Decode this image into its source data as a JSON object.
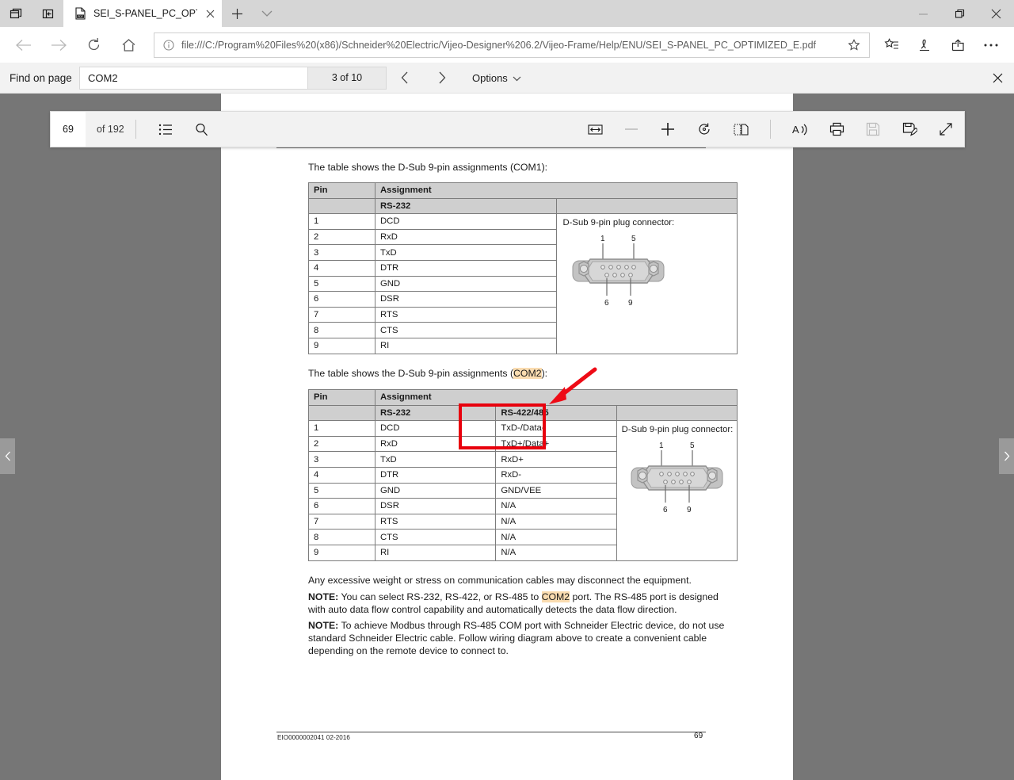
{
  "window": {
    "system_buttons": [
      "tab-preview-icon",
      "set-aside-tabs-icon"
    ],
    "controls": {
      "minimize": "minimize-icon",
      "restore": "restore-icon",
      "close": "close-icon"
    }
  },
  "tabstrip": {
    "tab_title": "SEI_S-PANEL_PC_OPTIM",
    "tab_icon": "pdf-file-icon",
    "close_icon": "close-icon",
    "new_tab_icon": "plus-icon",
    "tab_menu_icon": "chevron-down-icon"
  },
  "navbar": {
    "back_icon": "back-arrow-icon",
    "forward_icon": "forward-arrow-icon",
    "refresh_icon": "refresh-icon",
    "home_icon": "home-icon",
    "info_icon": "info-circle-icon",
    "url": "file:///C:/Program%20Files%20(x86)/Schneider%20Electric/Vijeo-Designer%206.2/Vijeo-Frame/Help/ENU/SEI_S-PANEL_PC_OPTIMIZED_E.pdf",
    "star_icon": "favorite-star-icon",
    "actions": [
      {
        "name": "hub-favorites-icon",
        "label": "Hub"
      },
      {
        "name": "web-notes-icon",
        "label": "Make a Web Note"
      },
      {
        "name": "share-icon",
        "label": "Share"
      },
      {
        "name": "more-icon",
        "label": "More"
      }
    ]
  },
  "findbar": {
    "label": "Find on page",
    "query": "COM2",
    "placeholder": "Find on page",
    "match_count": "3 of 10",
    "prev_icon": "chevron-left-icon",
    "next_icon": "chevron-right-icon",
    "options_label": "Options",
    "options_caret": "chevron-down-icon",
    "close_icon": "close-icon"
  },
  "pdf_toolbar": {
    "current_page": "69",
    "total_pages": "of 192",
    "toc_icon": "table-of-contents-icon",
    "search_icon": "search-icon",
    "tools": [
      {
        "name": "fit-to-width-icon",
        "disabled": false
      },
      {
        "name": "zoom-out-icon",
        "disabled": true
      },
      {
        "name": "zoom-in-icon",
        "disabled": false
      },
      {
        "name": "rotate-icon",
        "disabled": false
      },
      {
        "name": "page-layout-icon",
        "disabled": false
      },
      {
        "name": "read-aloud-icon",
        "disabled": false
      },
      {
        "name": "print-icon",
        "disabled": false
      },
      {
        "name": "save-icon",
        "disabled": true
      },
      {
        "name": "save-as-icon",
        "disabled": false
      },
      {
        "name": "fullscreen-icon",
        "disabled": false
      }
    ]
  },
  "page_nav": {
    "prev_icon": "chevron-left-icon",
    "next_icon": "chevron-right-icon"
  },
  "document": {
    "intro_com1_pre": "The table shows the D-Sub 9-pin assignments (",
    "intro_com1_hl": "COM1",
    "intro_com1_post": "):",
    "intro_com2_pre": "The table shows the D-Sub 9-pin assignments (",
    "intro_com2_hl": "COM2",
    "intro_com2_post": "):",
    "connector_caption": "D-Sub 9-pin plug connector:",
    "connector_labels": {
      "top_left": "1",
      "top_right": "5",
      "bottom_left": "6",
      "bottom_right": "9"
    },
    "table_com1": {
      "header_pin": "Pin",
      "header_assignment": "Assignment",
      "subheader_rs232": "RS-232",
      "subheader_blank": "",
      "rows": [
        {
          "pin": "1",
          "rs232": "DCD"
        },
        {
          "pin": "2",
          "rs232": "RxD"
        },
        {
          "pin": "3",
          "rs232": "TxD"
        },
        {
          "pin": "4",
          "rs232": "DTR"
        },
        {
          "pin": "5",
          "rs232": "GND"
        },
        {
          "pin": "6",
          "rs232": "DSR"
        },
        {
          "pin": "7",
          "rs232": "RTS"
        },
        {
          "pin": "8",
          "rs232": "CTS"
        },
        {
          "pin": "9",
          "rs232": "RI"
        }
      ]
    },
    "table_com2": {
      "header_pin": "Pin",
      "header_assignment": "Assignment",
      "subheader_rs232": "RS-232",
      "subheader_rs422485": "RS-422/485",
      "rows": [
        {
          "pin": "1",
          "rs232": "DCD",
          "rs422485": "TxD-/Data-"
        },
        {
          "pin": "2",
          "rs232": "RxD",
          "rs422485": "TxD+/Data+"
        },
        {
          "pin": "3",
          "rs232": "TxD",
          "rs422485": "RxD+"
        },
        {
          "pin": "4",
          "rs232": "DTR",
          "rs422485": "RxD-"
        },
        {
          "pin": "5",
          "rs232": "GND",
          "rs422485": "GND/VEE"
        },
        {
          "pin": "6",
          "rs232": "DSR",
          "rs422485": "N/A"
        },
        {
          "pin": "7",
          "rs232": "RTS",
          "rs422485": "N/A"
        },
        {
          "pin": "8",
          "rs232": "CTS",
          "rs422485": "N/A"
        },
        {
          "pin": "9",
          "rs232": "RI",
          "rs422485": "N/A"
        }
      ]
    },
    "paragraph_weight": "Any excessive weight or stress on communication cables may disconnect the equipment.",
    "note1_label": "NOTE:",
    "note1_pre": " You can select RS-232, RS-422, or RS-485 to ",
    "note1_hl": "COM2",
    "note1_post": " port. The RS-485 port is designed with auto data flow control capability and automatically detects the data flow direction.",
    "note2_label": "NOTE:",
    "note2_text": " To achieve Modbus through RS-485 COM port with Schneider Electric device, do not use standard Schneider Electric cable. Follow wiring diagram above to create a convenient cable depending on the remote device to connect to.",
    "footer_doc_id": "EIO0000002041 02-2016",
    "footer_page": "69"
  },
  "annotations": {
    "highlight_color": "#fadcb0",
    "marker_color": "#e8000d",
    "rectangle_target": "RS-422/485 column rows 1-2",
    "arrow_target": "RS-422/485 header cell"
  }
}
